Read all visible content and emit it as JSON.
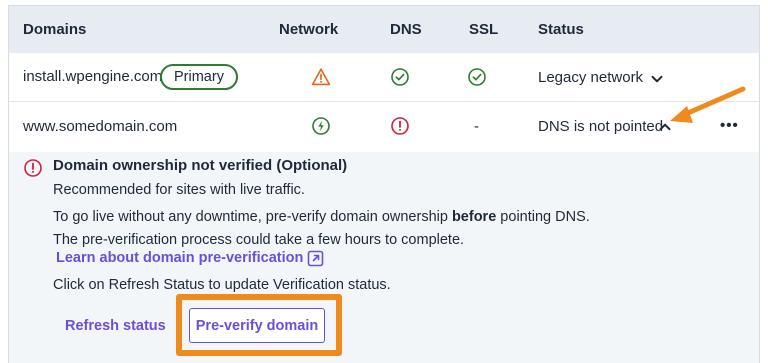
{
  "table": {
    "headers": {
      "domains": "Domains",
      "network": "Network",
      "dns": "DNS",
      "ssl": "SSL",
      "status": "Status"
    },
    "rows": [
      {
        "domain": "install.wpengine.com",
        "badge": "Primary",
        "network_icon": "warning-triangle-icon",
        "dns_icon": "check-circle-icon",
        "ssl_icon": "check-circle-icon",
        "status": "Legacy network"
      },
      {
        "domain": "www.somedomain.com",
        "network_icon": "lightning-circle-icon",
        "dns_icon": "error-circle-icon",
        "ssl": "-",
        "status": "DNS is not pointed",
        "menu": "•••"
      }
    ]
  },
  "panel": {
    "title": "Domain ownership not verified (Optional)",
    "subtitle": "Recommended for sites with live traffic.",
    "line1_pre": "To go live without any downtime, pre-verify domain ownership ",
    "line1_bold": "before",
    "line1_post": " pointing DNS.",
    "line2": "The pre-verification process could take a few hours to complete.",
    "link": "Learn about domain pre-verification",
    "instruction": "Click on Refresh Status to update Verification status.",
    "refresh_button": "Refresh status",
    "verify_button": "Pre-verify domain"
  },
  "colors": {
    "header_bg": "#e6ecf2",
    "panel_bg": "#f3f6f9",
    "success": "#2e7d32",
    "warning": "#e8641b",
    "error": "#d1213a",
    "accent": "#6d4ed6",
    "highlight": "#f08a1c"
  }
}
